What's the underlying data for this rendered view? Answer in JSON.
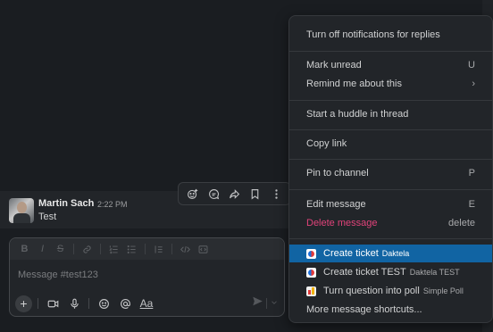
{
  "message": {
    "author": "Martin Sach",
    "time": "2:22 PM",
    "text": "Test"
  },
  "toolbar": {
    "icons": [
      "emoji-reaction-icon",
      "reply-thread-icon",
      "share-icon",
      "bookmark-icon",
      "more-actions-icon"
    ]
  },
  "composer": {
    "placeholder": "Message #test123",
    "format_icons": [
      "bold",
      "italic",
      "strikethrough",
      "link",
      "ordered-list",
      "bullet-list",
      "blockquote",
      "code",
      "code-block"
    ],
    "text_format_label": "Aa"
  },
  "menu": {
    "turn_off_notifications": "Turn off notifications for replies",
    "mark_unread": "Mark unread",
    "mark_unread_shortcut": "U",
    "remind_me": "Remind me about this",
    "remind_me_arrow": "›",
    "start_huddle": "Start a huddle in thread",
    "copy_link": "Copy link",
    "pin_to_channel": "Pin to channel",
    "pin_shortcut": "P",
    "edit_message": "Edit message",
    "edit_shortcut": "E",
    "delete_message": "Delete message",
    "delete_shortcut": "delete",
    "create_ticket": "Create ticket",
    "create_ticket_app": "Daktela",
    "create_ticket_test": "Create ticket TEST",
    "create_ticket_test_app": "Daktela TEST",
    "turn_into_poll": "Turn question into poll",
    "turn_into_poll_app": "Simple Poll",
    "more_shortcuts": "More message shortcuts..."
  },
  "colors": {
    "background": "#1a1d21",
    "highlight": "#1164a3",
    "danger": "#e0437a"
  }
}
